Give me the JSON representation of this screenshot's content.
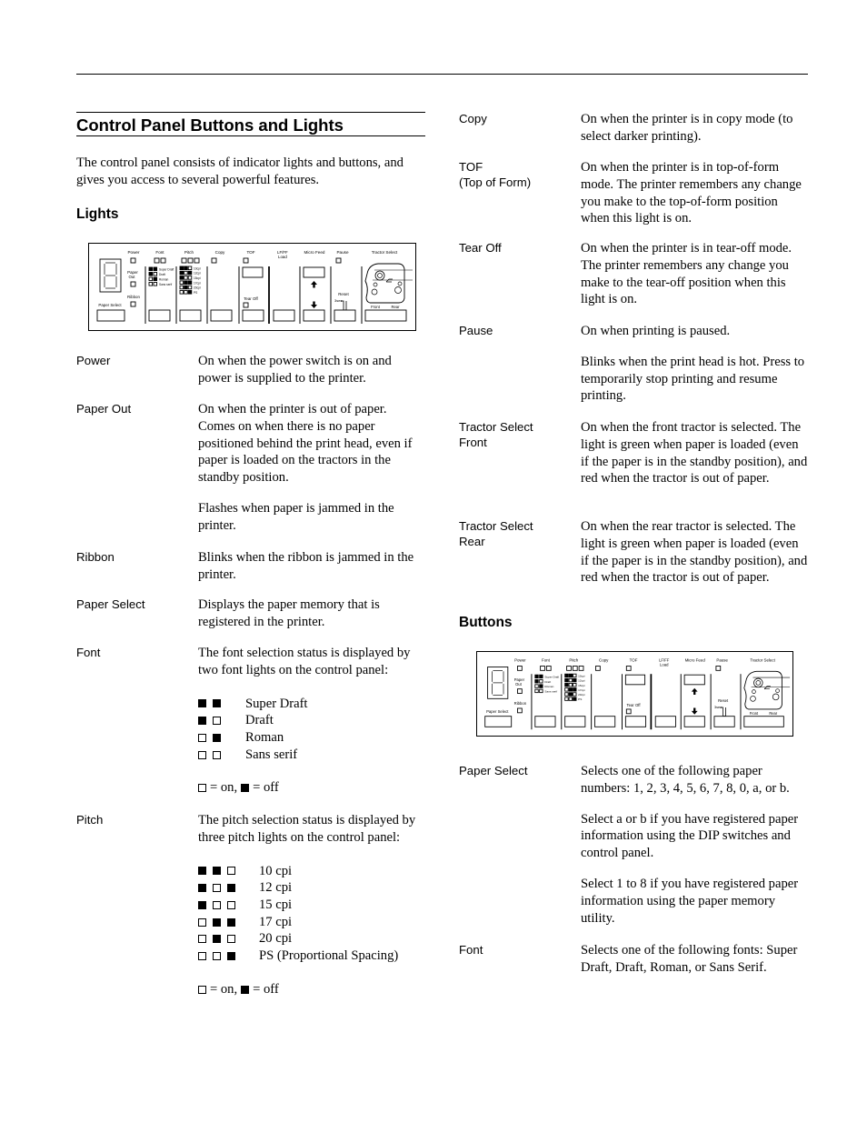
{
  "section_title": "Control Panel Buttons and Lights",
  "intro": "The control panel consists of indicator lights and buttons, and gives you access to several powerful features.",
  "lights_heading": "Lights",
  "buttons_heading": "Buttons",
  "panel_diagram": {
    "labels": {
      "power": "Power",
      "font": "Font",
      "pitch": "Pitch",
      "copy": "Copy",
      "tof": "TOF",
      "lf_ff": "LF/FF",
      "load": "Load",
      "micro_feed": "Micro Feed",
      "pause": "Pause",
      "tractor_select": "Tractor Select",
      "paper": "Paper",
      "out": "Out",
      "ribbon": "Ribbon",
      "paper_select": "Paper Select",
      "tear_off": "Tear Off",
      "reset": "Reset",
      "3sec": "3sec",
      "front": "Front",
      "rear": "Rear"
    },
    "font_legend": [
      "Super Draft",
      "Draft",
      "Roman",
      "Sans serif"
    ],
    "pitch_legend": [
      "10cpi",
      "12cpi",
      "15cpi",
      "17cpi",
      "20cpi",
      "PS"
    ]
  },
  "lights": [
    {
      "term": "Power",
      "paragraphs": [
        "On when the power switch is on and power is supplied to the printer."
      ]
    },
    {
      "term": "Paper Out",
      "paragraphs": [
        "On when the printer is out of paper. Comes on when there is no paper positioned behind the print head, even if paper is loaded on the tractors in the standby position.",
        "Flashes when paper is jammed in the printer."
      ]
    },
    {
      "term": "Ribbon",
      "paragraphs": [
        "Blinks when the ribbon is jammed in the printer."
      ]
    },
    {
      "term": "Paper Select",
      "paragraphs": [
        "Displays the paper memory that is registered in the printer."
      ]
    },
    {
      "term": "Font",
      "paragraphs": [
        "The font selection status is displayed by two font lights on the control panel:"
      ]
    },
    {
      "term": "Pitch",
      "paragraphs": [
        "The pitch selection status is displayed by three pitch lights on the control panel:"
      ]
    },
    {
      "term": "Copy",
      "paragraphs": [
        "On when the printer is in copy mode (to select darker printing)."
      ]
    },
    {
      "term": "TOF\n(Top of Form)",
      "term_line1": "TOF",
      "term_line2": "(Top of Form)",
      "paragraphs": [
        "On when the printer is in top-of-form mode. The printer remembers any change you make to the top-of-form position when this light is on."
      ]
    },
    {
      "term": "Tear Off",
      "paragraphs": [
        "On when the printer is in tear-off mode. The printer remembers any change you make to the tear-off position when this light is on."
      ]
    },
    {
      "term": "Pause",
      "paragraphs": [
        "On when printing is paused.",
        "Blinks when the print head is hot. Press to temporarily stop printing and resume printing."
      ]
    },
    {
      "term_line1": "Tractor Select",
      "term_line2": "Front",
      "paragraphs": [
        "On when the front tractor is selected. The light is green when paper is loaded (even if the paper is in the standby position), and red when the tractor is out of paper."
      ]
    },
    {
      "term_line1": "Tractor Select",
      "term_line2": "Rear",
      "paragraphs": [
        "On when the rear tractor is selected. The light is green when paper is loaded (even if the paper is in the standby position), and red when the tractor is out of paper."
      ]
    }
  ],
  "font_table": [
    {
      "pattern": [
        1,
        1
      ],
      "label": "Super Draft"
    },
    {
      "pattern": [
        1,
        0
      ],
      "label": "Draft"
    },
    {
      "pattern": [
        0,
        1
      ],
      "label": "Roman"
    },
    {
      "pattern": [
        0,
        0
      ],
      "label": "Sans serif"
    }
  ],
  "pitch_table": [
    {
      "pattern": [
        1,
        1,
        0
      ],
      "label": "10 cpi"
    },
    {
      "pattern": [
        1,
        0,
        1
      ],
      "label": "12 cpi"
    },
    {
      "pattern": [
        1,
        0,
        0
      ],
      "label": "15 cpi"
    },
    {
      "pattern": [
        0,
        1,
        1
      ],
      "label": "17 cpi"
    },
    {
      "pattern": [
        0,
        1,
        0
      ],
      "label": "20 cpi"
    },
    {
      "pattern": [
        0,
        0,
        1
      ],
      "label": "PS (Proportional Spacing)"
    }
  ],
  "legend_key": {
    "on": "= on,",
    "off": "= off"
  },
  "buttons": [
    {
      "term": "Paper Select",
      "paragraphs": [
        "Selects one of the following paper numbers: 1, 2, 3, 4, 5, 6, 7, 8, 0, a, or b.",
        "Select a or b if you have registered paper information using the DIP switches and control panel.",
        "Select 1 to 8 if you have registered paper information using the paper memory utility."
      ]
    },
    {
      "term": "Font",
      "paragraphs": [
        "Selects one of the following fonts: Super Draft, Draft, Roman, or Sans Serif."
      ]
    }
  ]
}
